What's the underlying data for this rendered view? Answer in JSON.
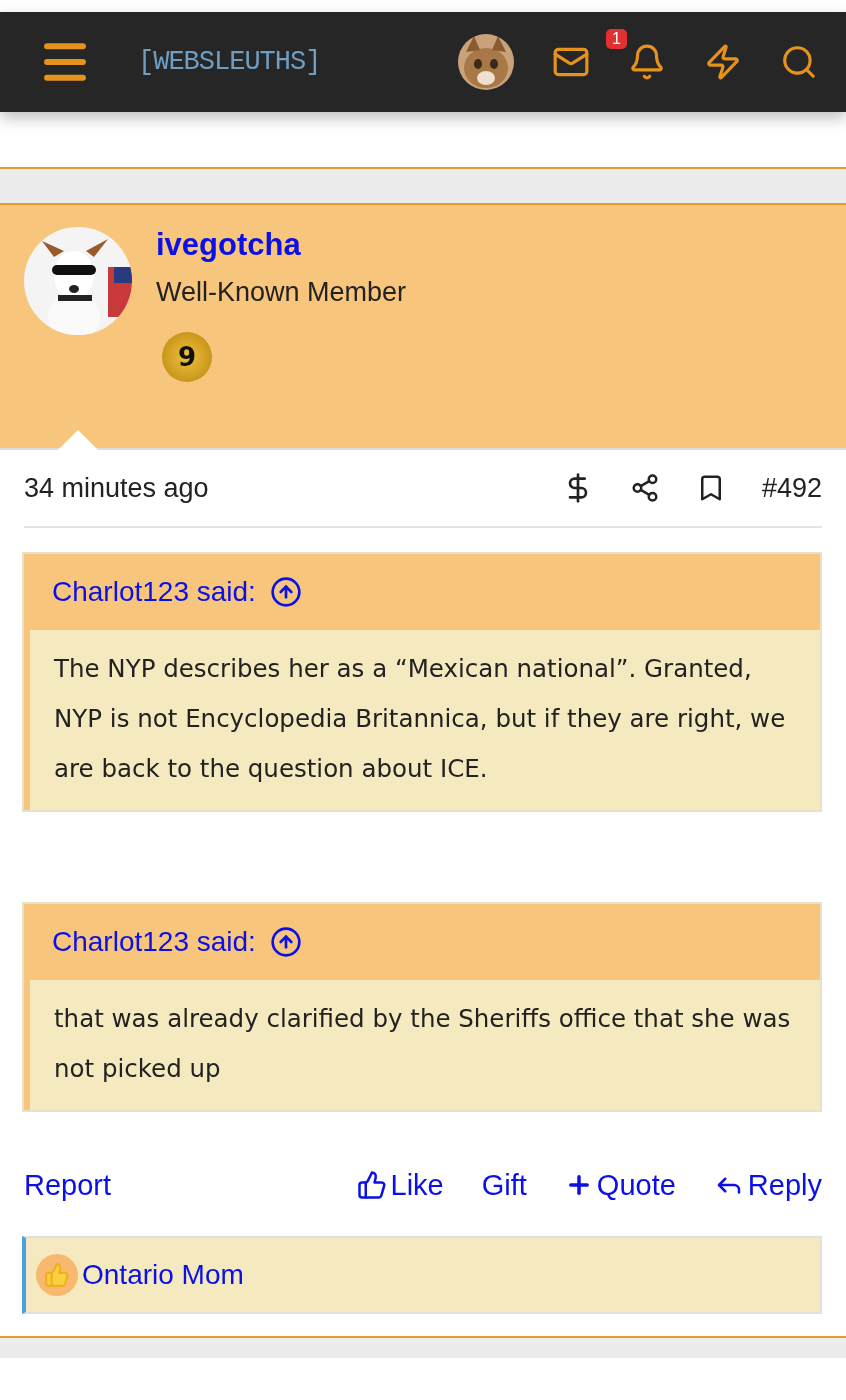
{
  "header": {
    "logo": "[WEBSLEUTHS]",
    "notification_count": "1"
  },
  "post": {
    "author": "ivegotcha",
    "user_title": "Well-Known Member",
    "trophy_badge": "9",
    "time": "34 minutes ago",
    "number": "#492",
    "quotes": [
      {
        "attribution": "Charlot123 said:",
        "text": "The NYP describes her as a “Mexican national”. Granted, NYP is not Encyclopedia Britannica, but if they are right, we are back to the question about ICE."
      },
      {
        "attribution": "Charlot123 said:",
        "text": "that was already clarified by the Sheriffs office that she was not picked up"
      }
    ],
    "actions": {
      "report": "Report",
      "like": "Like",
      "gift": "Gift",
      "quote": "Quote",
      "reply": "Reply"
    },
    "reactions": {
      "users": "Ontario Mom"
    }
  }
}
